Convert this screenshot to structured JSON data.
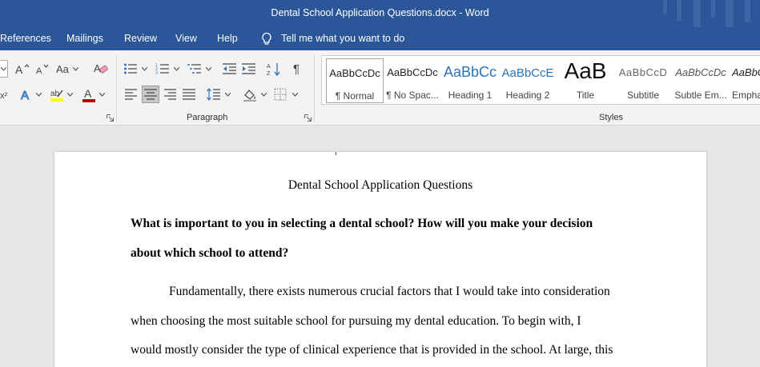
{
  "window": {
    "title": "Dental School Application Questions.docx  -  Word"
  },
  "tabs": [
    "References",
    "Mailings",
    "Review",
    "View",
    "Help"
  ],
  "tell_me": {
    "label": "Tell me what you want to do"
  },
  "ribbon": {
    "paragraph_label": "Paragraph",
    "styles_label": "Styles",
    "font_case_label": "Aa",
    "styles": [
      {
        "sample": "AaBbCcDc",
        "name": "¶ Normal"
      },
      {
        "sample": "AaBbCcDc",
        "name": "¶ No Spac..."
      },
      {
        "sample": "AaBbCc",
        "name": "Heading 1"
      },
      {
        "sample": "AaBbCcE",
        "name": "Heading 2"
      },
      {
        "sample": "AaB",
        "name": "Title"
      },
      {
        "sample": "AaBbCcD",
        "name": "Subtitle"
      },
      {
        "sample": "AaBbCcDc",
        "name": "Subtle Em..."
      },
      {
        "sample": "AaBbCcDc",
        "name": "Emphasis"
      }
    ]
  },
  "document": {
    "title": "Dental School Application Questions",
    "question_lines": [
      "What is important to you in selecting a dental school? How will you make your decision",
      "about which school to attend?"
    ],
    "body_lines": [
      "Fundamentally, there exists numerous crucial factors that I would take into consideration",
      "when choosing the most suitable school for pursuing my dental education. To begin with, I",
      "would mostly consider the type of clinical experience that is provided in the school. At large, this"
    ]
  },
  "colors": {
    "word_blue": "#2b579a",
    "ribbon_bg": "#f3f3f3",
    "doc_bg": "#e6e6e6",
    "font_color_red": "#c00000",
    "highlight_yellow": "#ffff00",
    "heading_blue": "#2e74b5"
  },
  "icons": {
    "tell_me": "lightbulb-icon",
    "grow_font": "grow-font-icon",
    "shrink_font": "shrink-font-icon",
    "clear_formatting": "eraser-icon",
    "text_effects": "text-effects-icon",
    "highlight": "highlighter-icon",
    "font_color": "font-color-icon",
    "bullets": "bullets-icon",
    "numbering": "numbering-icon",
    "multilevel": "multilevel-list-icon",
    "decrease_indent": "decrease-indent-icon",
    "increase_indent": "increase-indent-icon",
    "sort": "sort-icon",
    "show_marks": "pilcrow-icon",
    "align_left": "align-left-icon",
    "align_center": "align-center-icon",
    "align_right": "align-right-icon",
    "justify": "justify-icon",
    "line_spacing": "line-spacing-icon",
    "shading": "shading-icon",
    "borders": "borders-icon"
  }
}
